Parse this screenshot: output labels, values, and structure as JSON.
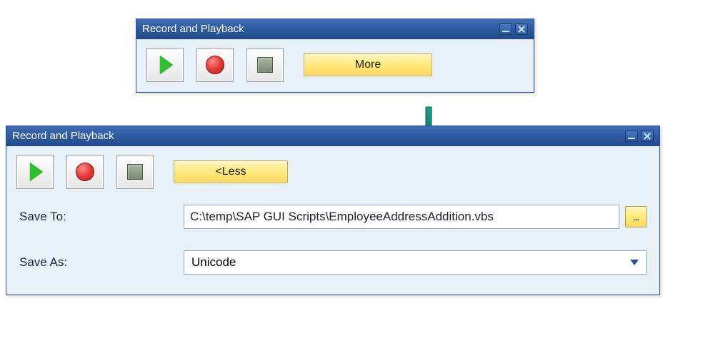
{
  "small_dialog": {
    "title": "Record and Playback",
    "more_label": "More"
  },
  "large_dialog": {
    "title": "Record and Playback",
    "less_label": "<Less",
    "save_to_label": "Save To:",
    "save_to_value": "C:\\temp\\SAP GUI Scripts\\EmployeeAddressAddition.vbs",
    "browse_label": "...",
    "save_as_label": "Save As:",
    "save_as_value": "Unicode"
  }
}
